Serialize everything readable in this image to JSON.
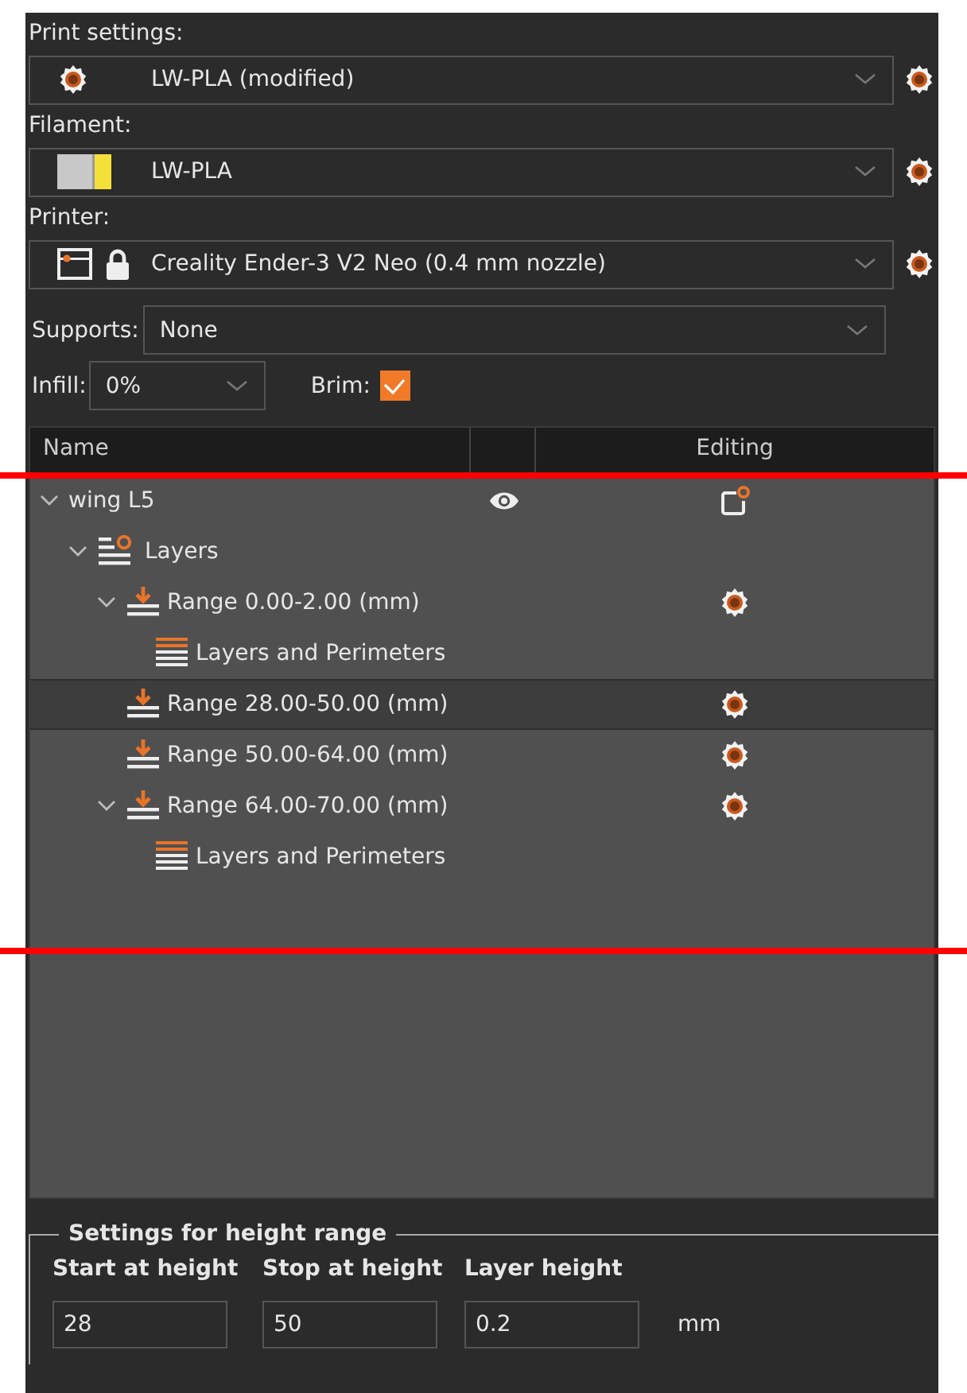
{
  "presets": [
    {
      "label": "Print settings:",
      "kind": "print",
      "value": "LW-PLA (modified)"
    },
    {
      "label": "Filament:",
      "kind": "filament",
      "value": "LW-PLA"
    },
    {
      "label": "Printer:",
      "kind": "printer",
      "value": "Creality Ender-3 V2 Neo (0.4 mm nozzle)"
    }
  ],
  "supports": {
    "label": "Supports:",
    "value": "None"
  },
  "infill": {
    "label": "Infill:",
    "value": "0%"
  },
  "brim": {
    "label": "Brim:",
    "checked": true
  },
  "tree": {
    "columns": [
      "Name",
      "Editing"
    ],
    "items": [
      {
        "label": "wing L5",
        "kind": "object",
        "expanded": true,
        "visible": true,
        "selected": false,
        "children": [
          {
            "label": "Layers",
            "kind": "layers",
            "expanded": true,
            "selected": false,
            "children": [
              {
                "label": "Range 0.00-2.00 (mm)",
                "kind": "range",
                "expanded": true,
                "selected": false,
                "children": [
                  {
                    "label": "Layers and Perimeters",
                    "kind": "settings",
                    "selected": false
                  }
                ]
              },
              {
                "label": "Range 28.00-50.00 (mm)",
                "kind": "range",
                "selected": true
              },
              {
                "label": "Range 50.00-64.00 (mm)",
                "kind": "range",
                "selected": false
              },
              {
                "label": "Range 64.00-70.00 (mm)",
                "kind": "range",
                "expanded": true,
                "selected": false,
                "children": [
                  {
                    "label": "Layers and Perimeters",
                    "kind": "settings",
                    "selected": false
                  }
                ]
              }
            ]
          }
        ]
      }
    ]
  },
  "height_range": {
    "title": "Settings for height range",
    "fields": [
      {
        "label": "Start at height",
        "value": "28"
      },
      {
        "label": "Stop at height",
        "value": "50"
      },
      {
        "label": "Layer height",
        "value": "0.2"
      }
    ],
    "unit": "mm"
  },
  "overlay_lines": [
    {
      "color": "#ff0000"
    },
    {
      "color": "#ff0000"
    }
  ]
}
